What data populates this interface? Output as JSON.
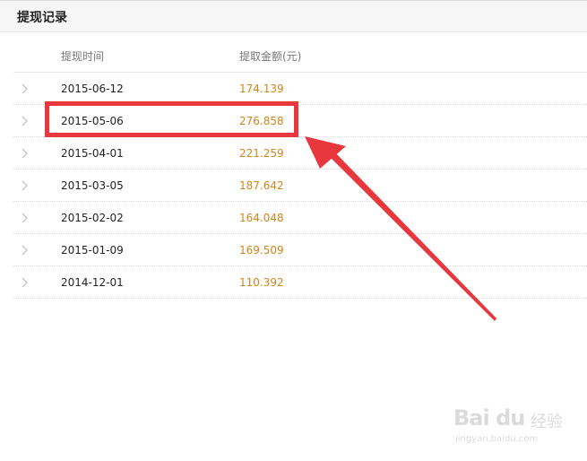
{
  "header": {
    "title": "提现记录"
  },
  "table": {
    "columns": {
      "date": "提现时间",
      "amount": "提取金额(元)"
    },
    "rows": [
      {
        "date": "2015-06-12",
        "amount": "174.139"
      },
      {
        "date": "2015-05-06",
        "amount": "276.858"
      },
      {
        "date": "2015-04-01",
        "amount": "221.259"
      },
      {
        "date": "2015-03-05",
        "amount": "187.642"
      },
      {
        "date": "2015-02-02",
        "amount": "164.048"
      },
      {
        "date": "2015-01-09",
        "amount": "169.509"
      },
      {
        "date": "2014-12-01",
        "amount": "110.392"
      }
    ]
  },
  "annotation": {
    "highlight_color": "#e8383d",
    "highlighted_row_index": 1
  },
  "watermark": {
    "logo": "Bai du",
    "suffix": "经验",
    "url": "jingyan.baidu.com"
  },
  "colors": {
    "amount_text": "#d1841c",
    "header_bg": "#f6f6f6"
  }
}
